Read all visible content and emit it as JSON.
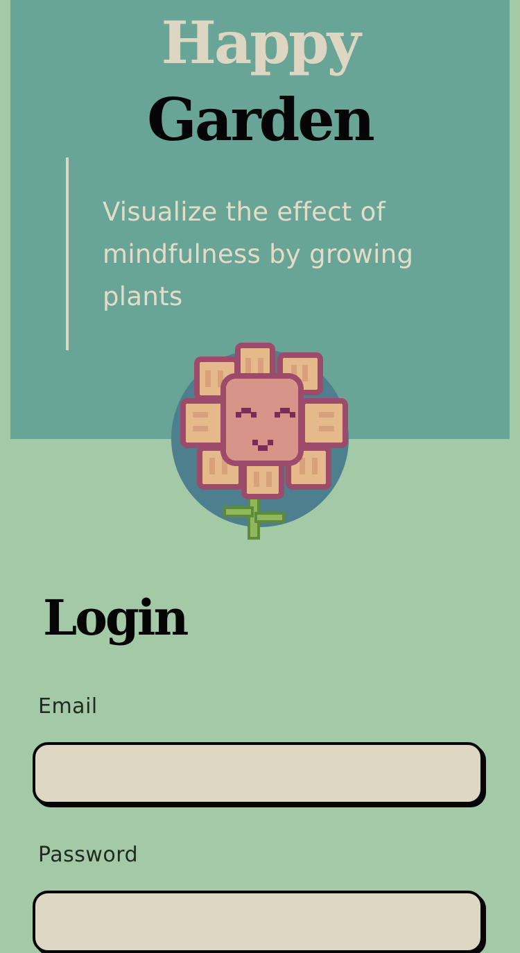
{
  "hero": {
    "title_line1": "Happy",
    "title_line2": "Garden",
    "tagline": "Visualize the effect of mindfulness by growing plants",
    "mascot_icon": "smiling-flower-icon"
  },
  "login": {
    "title": "Login",
    "email_label": "Email",
    "email_value": "",
    "password_label": "Password",
    "password_value": ""
  },
  "colors": {
    "page_background": "#a3c9a7",
    "hero_background": "#68a597",
    "cream": "#ddd6c3",
    "ink": "#050505",
    "avatar_circle": "#4d7f8e",
    "petal": "#e5b98a",
    "petal_outline": "#9c4b6b",
    "face": "#d79589",
    "stem": "#8fb85a"
  }
}
